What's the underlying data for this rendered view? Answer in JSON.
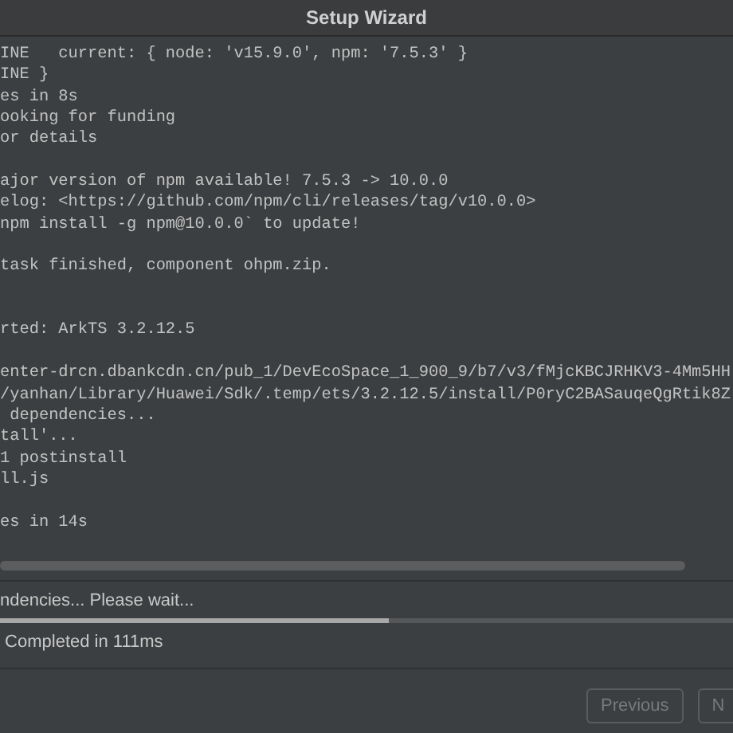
{
  "window": {
    "title": "Setup Wizard"
  },
  "log": {
    "blocks": [
      [
        "INE   current: { node: 'v15.9.0', npm: '7.5.3' }",
        "INE }",
        "es in 8s",
        "ooking for funding",
        "or details"
      ],
      [
        "ajor version of npm available! 7.5.3 -> 10.0.0",
        "elog: <https://github.com/npm/cli/releases/tag/v10.0.0>",
        "npm install -g npm@10.0.0` to update!"
      ],
      [
        "task finished, component ohpm.zip."
      ],
      [
        "rted: ArkTS 3.2.12.5"
      ],
      [
        "enter-drcn.dbankcdn.cn/pub_1/DevEcoSpace_1_900_9/b7/v3/fMjcKBCJRHKV3-4Mm5HH",
        "/yanhan/Library/Huawei/Sdk/.temp/ets/3.2.12.5/install/P0ryC2BASauqeQgRtik8Z",
        " dependencies...",
        "tall'...",
        "1 postinstall",
        "ll.js"
      ],
      [
        "es in 14s"
      ]
    ]
  },
  "progress": {
    "status": "ndencies... Please wait...",
    "level": 0.53,
    "detail": " Completed in 111ms"
  },
  "buttons": [
    {
      "label": "Previous",
      "disabled": true
    },
    {
      "label": "N",
      "disabled": true
    }
  ]
}
